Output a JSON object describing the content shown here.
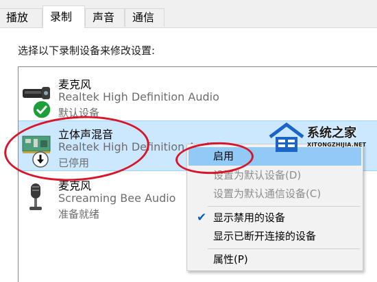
{
  "tabs": [
    {
      "label": "播放"
    },
    {
      "label": "录制"
    },
    {
      "label": "声音"
    },
    {
      "label": "通信"
    }
  ],
  "instruction": "选择以下录制设备来修改设置:",
  "devices": [
    {
      "name": "麦克风",
      "description": "Realtek High Definition Audio",
      "status": "默认设备",
      "icon": "microphone-headset-icon",
      "badge": "default-check-icon"
    },
    {
      "name": "立体声混音",
      "description": "Realtek High Definition Audio",
      "status": "已停用",
      "icon": "sound-card-icon",
      "badge": "disabled-arrow-icon"
    },
    {
      "name": "麦克风",
      "description": "Screaming Bee Audio",
      "status": "准备就绪",
      "icon": "desk-microphone-icon"
    }
  ],
  "context_menu": {
    "items": [
      {
        "label": "启用",
        "enabled": true,
        "highlighted": true
      },
      {
        "label": "设置为默认设备(D)",
        "enabled": false
      },
      {
        "label": "设置为默认通信设备(C)",
        "enabled": false
      },
      {
        "label": "显示禁用的设备",
        "enabled": true,
        "checked": true
      },
      {
        "label": "显示已断开连接的设备",
        "enabled": true
      },
      {
        "label": "属性(P)",
        "enabled": true
      }
    ]
  },
  "watermark": {
    "title": "系统之家",
    "subtitle": "XITONGZHIJIA.NET"
  },
  "colors": {
    "selection": "#cce8ff",
    "menu_highlight": "#91c9f7",
    "annotation": "#d8152a",
    "check_green": "#1e9e3a"
  }
}
